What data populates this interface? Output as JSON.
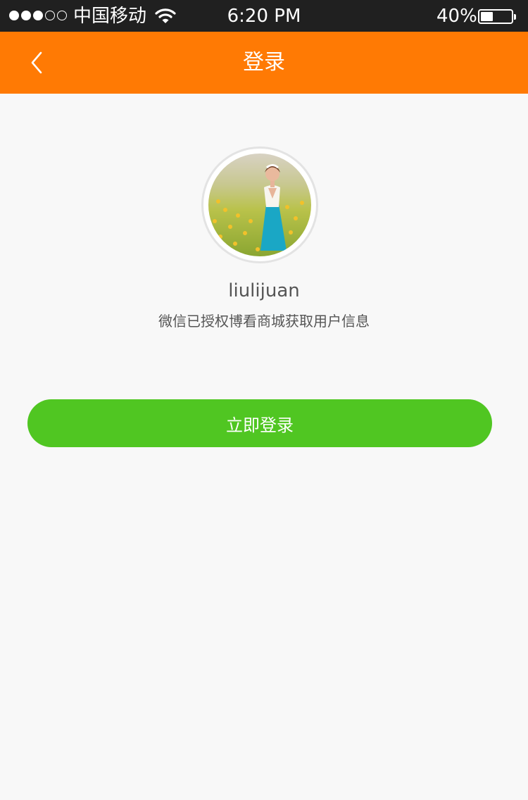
{
  "status_bar": {
    "carrier": "中国移动",
    "time": "6:20 PM",
    "battery_percent": "40%",
    "battery_level": 0.4,
    "signal_bars_filled": 3,
    "signal_bars_total": 5,
    "icons": [
      "signal-dots-icon",
      "wifi-icon",
      "battery-icon"
    ]
  },
  "nav": {
    "title": "登录",
    "back_icon": "chevron-left-icon"
  },
  "profile": {
    "username": "liulijuan",
    "auth_message": "微信已授权博看商城获取用户信息",
    "avatar": "user-avatar-photo"
  },
  "actions": {
    "login_label": "立即登录"
  },
  "colors": {
    "status_bar": "#202020",
    "nav_bar": "#ff7a04",
    "page_background": "#f8f8f8",
    "login_button": "#50c622",
    "text_secondary": "#555555"
  }
}
